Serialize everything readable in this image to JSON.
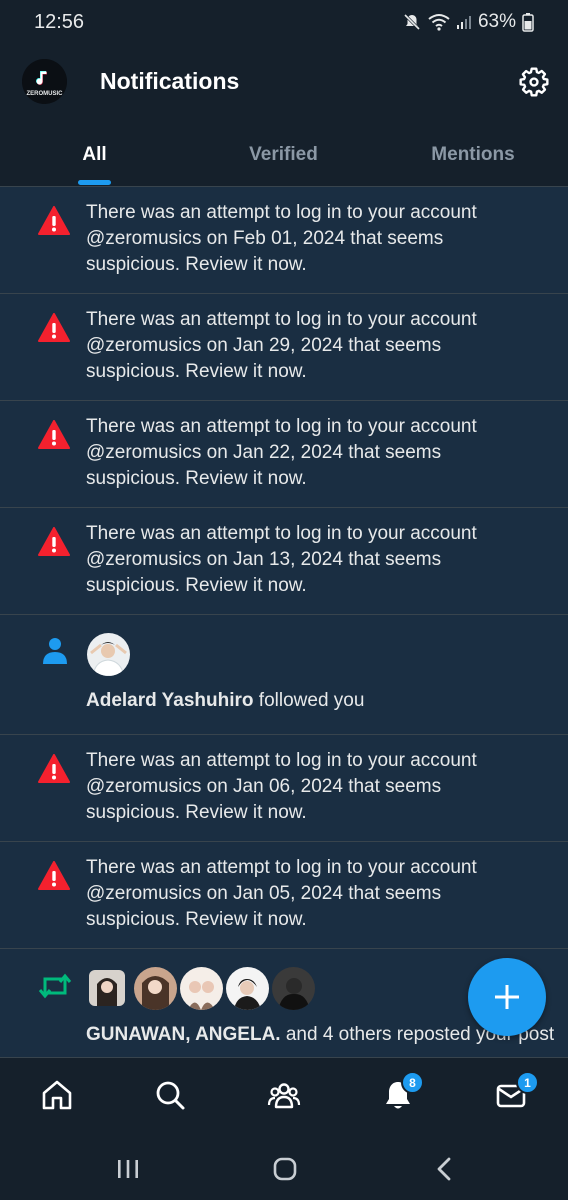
{
  "status_bar": {
    "time": "12:56",
    "battery": "63%"
  },
  "header": {
    "title": "Notifications",
    "logo_text": "ZEROMUSIC"
  },
  "tabs": [
    {
      "label": "All",
      "active": true
    },
    {
      "label": "Verified",
      "active": false
    },
    {
      "label": "Mentions",
      "active": false
    }
  ],
  "notifications": [
    {
      "type": "alert",
      "icon": "warning-icon",
      "text": "There was an attempt to log in to your account @zeromusics on Feb 01, 2024 that seems suspicious. Review it now."
    },
    {
      "type": "alert",
      "icon": "warning-icon",
      "text": "There was an attempt to log in to your account @zeromusics on Jan 29, 2024 that seems suspicious. Review it now."
    },
    {
      "type": "alert",
      "icon": "warning-icon",
      "text": "There was an attempt to log in to your account @zeromusics on Jan 22, 2024 that seems suspicious. Review it now."
    },
    {
      "type": "alert",
      "icon": "warning-icon",
      "text": "There was an attempt to log in to your account @zeromusics on Jan 13, 2024 that seems suspicious. Review it now."
    },
    {
      "type": "follow",
      "icon": "person-icon",
      "name": "Adelard Yashuhiro",
      "action": " followed you"
    },
    {
      "type": "alert",
      "icon": "warning-icon",
      "text": "There was an attempt to log in to your account @zeromusics on Jan 06, 2024 that seems suspicious. Review it now."
    },
    {
      "type": "alert",
      "icon": "warning-icon",
      "text": "There was an attempt to log in to your account @zeromusics on Jan 05, 2024 that seems suspicious. Review it now."
    },
    {
      "type": "repost",
      "icon": "repost-icon",
      "names": "GUNAWAN, ANGELA.",
      "action": " and 4 others reposted your post"
    }
  ],
  "bottom_nav": {
    "items": [
      "home-icon",
      "search-icon",
      "communities-icon",
      "bell-icon",
      "mail-icon"
    ],
    "notifications_badge": "8",
    "messages_badge": "1"
  },
  "colors": {
    "background": "#15202b",
    "row_unread": "#1a2e42",
    "accent": "#1d9bf0",
    "alert": "#f4212e",
    "repost": "#00ba7c"
  }
}
